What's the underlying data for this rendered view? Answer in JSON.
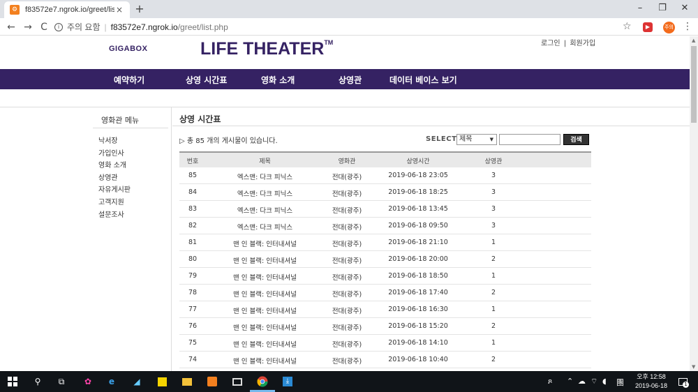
{
  "browser": {
    "tab_title": "f83572e7.ngrok.io/greet/list.php",
    "tab_close": "×",
    "new_tab": "+",
    "win_min": "–",
    "win_max": "❐",
    "win_close": "✕",
    "nav_back": "←",
    "nav_forward": "→",
    "nav_reload": "C",
    "security_text": "주의 요함",
    "url_host": "f83572e7.ngrok.io",
    "url_path": "/greet/list.php",
    "ext2_label": "주의"
  },
  "site": {
    "gigabox": "GIGABOX",
    "brand": "LIFE THEATER",
    "brand_tm": "TM",
    "login": "로그인",
    "divider": "|",
    "signup": "회원가입",
    "nav": [
      "예약하기",
      "상영 시간표",
      "영화 소개",
      "상영관",
      "데이터 베이스 보기"
    ],
    "accent_color": "#352263"
  },
  "sidebar": {
    "title": "영화관 메뉴",
    "items": [
      "낙서장",
      "가입인사",
      "영화 소개",
      "상영관",
      "자유게시판",
      "고객지원",
      "설문조사"
    ]
  },
  "content": {
    "title": "상영 시간표",
    "total_text": "▷ 총 85 개의 게시물이 있습니다.",
    "select_label": "SELECT",
    "select_value": "제목",
    "search_button": "검색",
    "columns": [
      "번호",
      "제목",
      "영화관",
      "상영시간",
      "상영관"
    ],
    "rows": [
      {
        "no": "85",
        "title": "엑스맨: 다크 피닉스",
        "hall": "전대(광주)",
        "time": "2019-06-18 23:05",
        "screen": "3"
      },
      {
        "no": "84",
        "title": "엑스맨: 다크 피닉스",
        "hall": "전대(광주)",
        "time": "2019-06-18 18:25",
        "screen": "3"
      },
      {
        "no": "83",
        "title": "엑스맨: 다크 피닉스",
        "hall": "전대(광주)",
        "time": "2019-06-18 13:45",
        "screen": "3"
      },
      {
        "no": "82",
        "title": "엑스맨: 다크 피닉스",
        "hall": "전대(광주)",
        "time": "2019-06-18 09:50",
        "screen": "3"
      },
      {
        "no": "81",
        "title": "맨 인 블랙: 인터내셔널",
        "hall": "전대(광주)",
        "time": "2019-06-18 21:10",
        "screen": "1"
      },
      {
        "no": "80",
        "title": "맨 인 블랙: 인터내셔널",
        "hall": "전대(광주)",
        "time": "2019-06-18 20:00",
        "screen": "2"
      },
      {
        "no": "79",
        "title": "맨 인 블랙: 인터내셔널",
        "hall": "전대(광주)",
        "time": "2019-06-18 18:50",
        "screen": "1"
      },
      {
        "no": "78",
        "title": "맨 인 블랙: 인터내셔널",
        "hall": "전대(광주)",
        "time": "2019-06-18 17:40",
        "screen": "2"
      },
      {
        "no": "77",
        "title": "맨 인 블랙: 인터내셔널",
        "hall": "전대(광주)",
        "time": "2019-06-18 16:30",
        "screen": "1"
      },
      {
        "no": "76",
        "title": "맨 인 블랙: 인터내셔널",
        "hall": "전대(광주)",
        "time": "2019-06-18 15:20",
        "screen": "2"
      },
      {
        "no": "75",
        "title": "맨 인 블랙: 인터내셔널",
        "hall": "전대(광주)",
        "time": "2019-06-18 14:10",
        "screen": "1"
      },
      {
        "no": "74",
        "title": "맨 인 블랙: 인터내셔널",
        "hall": "전대(광주)",
        "time": "2019-06-18 10:40",
        "screen": "2"
      }
    ]
  },
  "taskbar": {
    "ampm_time": "오후 12:58",
    "date": "2019-06-18",
    "notif_count": "1"
  }
}
